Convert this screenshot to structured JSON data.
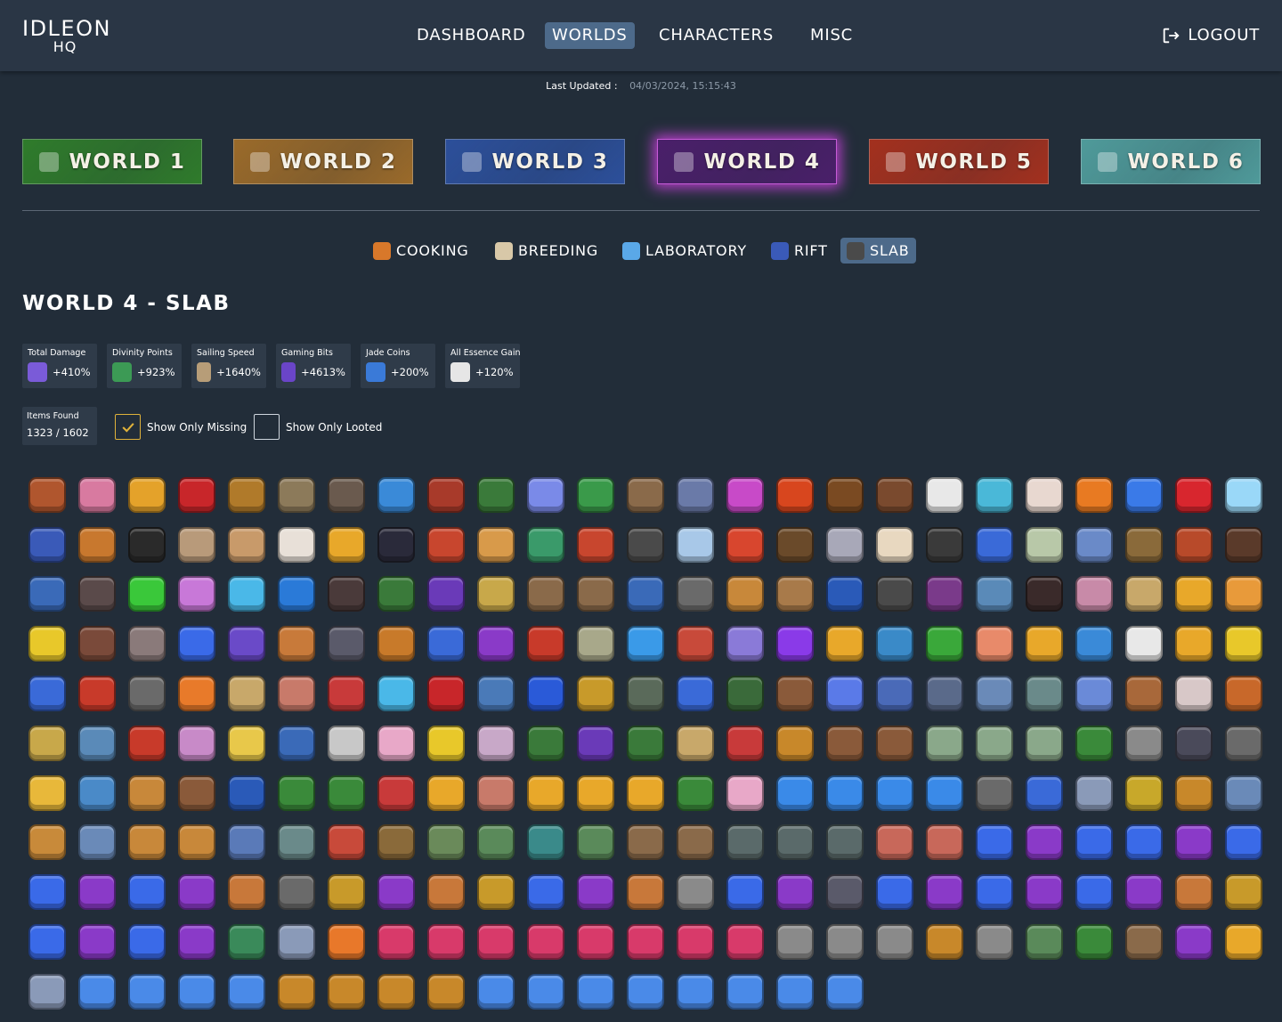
{
  "app": {
    "logo_line1": "IDLEON",
    "logo_line2": "HQ"
  },
  "nav": {
    "items": [
      {
        "label": "DASHBOARD",
        "active": false
      },
      {
        "label": "WORLDS",
        "active": true
      },
      {
        "label": "CHARACTERS",
        "active": false
      },
      {
        "label": "MISC",
        "active": false
      }
    ],
    "logout_label": "LOGOUT"
  },
  "last_updated": {
    "label": "Last Updated :",
    "value": "04/03/2024, 15:15:43"
  },
  "worlds": [
    {
      "label": "WORLD 1",
      "color": "#2f7b2b",
      "icon": "world1-icon",
      "active": false
    },
    {
      "label": "WORLD 2",
      "color": "#9a6a2a",
      "icon": "world2-icon",
      "active": false
    },
    {
      "label": "WORLD 3",
      "color": "#2c4f9a",
      "icon": "world3-icon",
      "active": false
    },
    {
      "label": "WORLD 4",
      "color": "#4a1f6a",
      "icon": "world4-icon",
      "active": true
    },
    {
      "label": "WORLD 5",
      "color": "#a3301e",
      "icon": "world5-icon",
      "active": false
    },
    {
      "label": "WORLD 6",
      "color": "#4f9a9a",
      "icon": "world6-icon",
      "active": false
    }
  ],
  "subnav": [
    {
      "label": "COOKING",
      "icon": "cooking-icon",
      "active": false
    },
    {
      "label": "BREEDING",
      "icon": "breeding-icon",
      "active": false
    },
    {
      "label": "LABORATORY",
      "icon": "laboratory-icon",
      "active": false
    },
    {
      "label": "RIFT",
      "icon": "rift-icon",
      "active": false
    },
    {
      "label": "SLAB",
      "icon": "slab-icon",
      "active": true
    }
  ],
  "page_title": "WORLD 4 - SLAB",
  "stats": [
    {
      "label": "Total Damage",
      "value": "+410%",
      "icon": "damage-cube-icon",
      "color": "#7a5bd8"
    },
    {
      "label": "Divinity Points",
      "value": "+923%",
      "icon": "divinity-icon",
      "color": "#3c9a55"
    },
    {
      "label": "Sailing Speed",
      "value": "+1640%",
      "icon": "sailing-icon",
      "color": "#b79d78"
    },
    {
      "label": "Gaming Bits",
      "value": "+4613%",
      "icon": "gaming-bits-icon",
      "color": "#6a45c8"
    },
    {
      "label": "Jade Coins",
      "value": "+200%",
      "icon": "jade-coin-icon",
      "color": "#3a7ad8"
    },
    {
      "label": "All Essence Gain",
      "value": "+120%",
      "icon": "essence-icon",
      "color": "#e6e6e6"
    }
  ],
  "items_found": {
    "label": "Items Found",
    "value": "1323 / 1602"
  },
  "filters": [
    {
      "label": "Show Only Missing",
      "checked": true
    },
    {
      "label": "Show Only Looted",
      "checked": false
    }
  ],
  "item_colors": [
    "#b0562e",
    "#d87aa0",
    "#e4a22a",
    "#c8262a",
    "#b07a2a",
    "#8c7a5a",
    "#6a5a4e",
    "#3a8ad8",
    "#a83a2a",
    "#3a7a3a",
    "#7a8ae8",
    "#3a9a4a",
    "#8a6a4a",
    "#6a7aa8",
    "#c84ac8",
    "#d8461e",
    "#7a4a22",
    "#7a4a2e",
    "#e8e8e8",
    "#4ab8d8",
    "#e8d8d0",
    "#e87a22",
    "#3a7ae8",
    "#d8262e",
    "#9ad8f8",
    "#3a5ab8",
    "#c8782e",
    "#2a2a2a",
    "#b89a7a",
    "#c89a6a",
    "#e8e0d8",
    "#e8a82a",
    "#2a2a3a",
    "#c8462e",
    "#d89a4a",
    "#3a9a6a",
    "#c8462e",
    "#4a4a4a",
    "#a8c8e8",
    "#d8462e",
    "#6a4a2a",
    "#a8a8b8",
    "#e8d8c0",
    "#3a3a3a",
    "#3a6ad8",
    "#b8c8a8",
    "#6a8ac8",
    "#8a6a3a",
    "#b84a2a",
    "#5a3a2a",
    "#3a6ab8",
    "#5a4a4a",
    "#3ac83a",
    "#c878d8",
    "#4ab8e8",
    "#2a7ad8",
    "#4a3a3a",
    "#3a7a3a",
    "#6a3ab8",
    "#c8a84a",
    "#8a6a4a",
    "#8a6a4a",
    "#3a6ab8",
    "#6a6a6a",
    "#c8883a",
    "#a87a4a",
    "#2a5ab8",
    "#4a4a4a",
    "#7a3a8a",
    "#5a8ab8",
    "#3a2a2a",
    "#c88aa8",
    "#c8a86a",
    "#e8a82a",
    "#e89a3a",
    "#e8c82a",
    "#7a4a3a",
    "#8a7a7a",
    "#3a6ae8",
    "#6a4ac8",
    "#c87a3a",
    "#5a5a6a",
    "#c87a2a",
    "#3a6ad8",
    "#8a3ac8",
    "#c83a2a",
    "#a8a88a",
    "#3a9ae8",
    "#c84a3a",
    "#8a7ad8",
    "#8a3ae8",
    "#e8a82a",
    "#3a8ac8",
    "#3aa83a",
    "#e88a6a",
    "#e8a82a",
    "#3a8ad8",
    "#e8e8e8",
    "#e8a82a",
    "#e8c82a",
    "#3a6ad8",
    "#c83a2a",
    "#6a6a6a",
    "#e87a2a",
    "#c8a86a",
    "#c87a6a",
    "#c83a3a",
    "#4ab8e8",
    "#c8262a",
    "#4a7ab8",
    "#2a5ad8",
    "#c89a2a",
    "#5a6a5a",
    "#3a6ad8",
    "#3a6a3a",
    "#8a5a3a",
    "#5a7ae8",
    "#4a6ab8",
    "#5a6a8a",
    "#6a8ab8",
    "#6a8a8a",
    "#6a8ad8",
    "#a8683a",
    "#d8c8c8",
    "#c8682a",
    "#c8a84a",
    "#5a8ab8",
    "#c83a2a",
    "#c88ac8",
    "#e8c84a",
    "#3a6ab8",
    "#c8c8c8",
    "#e8a8c8",
    "#e8c82a",
    "#c8a8c8",
    "#3a7a3a",
    "#6a3ab8",
    "#3a7a3a",
    "#c8a86a",
    "#c83a3a",
    "#c8882a",
    "#8a5a3a",
    "#8a5a3a",
    "#8aa88a",
    "#8aa88a",
    "#8aa88a",
    "#3a8a3a",
    "#8a8a8a",
    "#4a4a5a",
    "#6a6a6a",
    "#e8b83a",
    "#4a8ac8",
    "#c8883a",
    "#8a5a3a",
    "#2a5ab8",
    "#3a8a3a",
    "#3a8a3a",
    "#c83a3a",
    "#e8a82a",
    "#c87a6a",
    "#e8a82a",
    "#e8a82a",
    "#e8a82a",
    "#3a8a3a",
    "#e8a8c8",
    "#3a8ae8",
    "#3a8ae8",
    "#3a8ae8",
    "#3a8ae8",
    "#6a6a6a",
    "#3a6ad8",
    "#8a9ab8",
    "#c8a82a",
    "#c8882a",
    "#6a8ab8",
    "#c88a3a",
    "#6a8ab8",
    "#c8883a",
    "#c8883a",
    "#5a7ab8",
    "#6a8a8a",
    "#c84a3a",
    "#8a6a3a",
    "#6a8a5a",
    "#5a8a5a",
    "#3a8a8a",
    "#5a8a5a",
    "#8a6a4a",
    "#8a6a4a",
    "#5a6a6a",
    "#5a6a6a",
    "#5a6a6a",
    "#c8685a",
    "#c8685a",
    "#3a6ae8",
    "#8a3ac8",
    "#3a6ae8",
    "#3a6ae8",
    "#8a3ac8",
    "#3a6ae8",
    "#3a6ae8",
    "#8a3ac8",
    "#3a6ae8",
    "#8a3ac8",
    "#c8783a",
    "#6a6a6a",
    "#c89a2a",
    "#8a3ac8",
    "#c8783a",
    "#c89a2a",
    "#3a6ae8",
    "#8a3ac8",
    "#c8783a",
    "#8a8a8a",
    "#3a6ae8",
    "#8a3ac8",
    "#5a5a6a",
    "#3a6ae8",
    "#8a3ac8",
    "#3a6ae8",
    "#8a3ac8",
    "#3a6ae8",
    "#8a3ac8",
    "#c8783a",
    "#c89a2a",
    "#3a6ae8",
    "#8a3ac8",
    "#3a6ae8",
    "#8a3ac8",
    "#3a8a5a",
    "#8a9ab8",
    "#e8782a",
    "#d83a6a",
    "#d83a6a",
    "#d83a6a",
    "#d83a6a",
    "#d83a6a",
    "#d83a6a",
    "#d83a6a",
    "#d83a6a",
    "#8a8a8a",
    "#8a8a8a",
    "#8a8a8a",
    "#c8882a",
    "#8a8a8a",
    "#5a8a5a",
    "#3a8a3a",
    "#8a6a4a",
    "#8a3ac8",
    "#e8a82a",
    "#8a9ab8",
    "#4a8ae8",
    "#4a8ae8",
    "#4a8ae8",
    "#4a8ae8",
    "#c8882a",
    "#c8882a",
    "#c8882a",
    "#c8882a",
    "#4a8ae8",
    "#4a8ae8",
    "#4a8ae8",
    "#4a8ae8",
    "#4a8ae8",
    "#4a8ae8",
    "#4a8ae8",
    "#4a8ae8"
  ]
}
